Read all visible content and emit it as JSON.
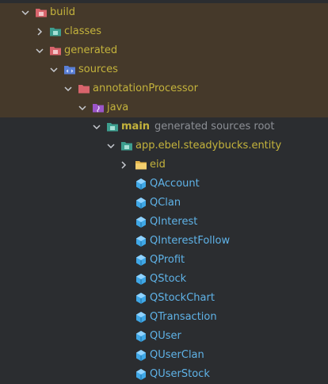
{
  "tree": {
    "build": {
      "label": "build"
    },
    "classes": {
      "label": "classes"
    },
    "generated": {
      "label": "generated"
    },
    "sources": {
      "label": "sources"
    },
    "annotationProcessor": {
      "label": "annotationProcessor"
    },
    "java": {
      "label": "java"
    },
    "main": {
      "label": "main",
      "hint": "generated sources root"
    },
    "package": {
      "label": "app.ebel.steadybucks.entity"
    },
    "eid": {
      "label": "eid"
    },
    "classes_list": [
      {
        "label": "QAccount"
      },
      {
        "label": "QClan"
      },
      {
        "label": "QInterest"
      },
      {
        "label": "QInterestFollow"
      },
      {
        "label": "QProfit"
      },
      {
        "label": "QStock"
      },
      {
        "label": "QStockChart"
      },
      {
        "label": "QTransaction"
      },
      {
        "label": "QUser"
      },
      {
        "label": "QUserClan"
      },
      {
        "label": "QUserStock"
      }
    ]
  },
  "icons": {
    "expanded": "chevron-down-icon",
    "collapsed": "chevron-right-icon",
    "excluded_folder": "excluded-folder-icon",
    "source_root": "source-root-folder-icon",
    "package": "package-folder-icon",
    "class": "java-class-icon"
  },
  "colors": {
    "background": "#2b2d30",
    "excluded_row": "#45392a",
    "label_olive": "#c4b33c",
    "hint_gray": "#8c8f95",
    "class_blue": "#5fb3e8"
  }
}
